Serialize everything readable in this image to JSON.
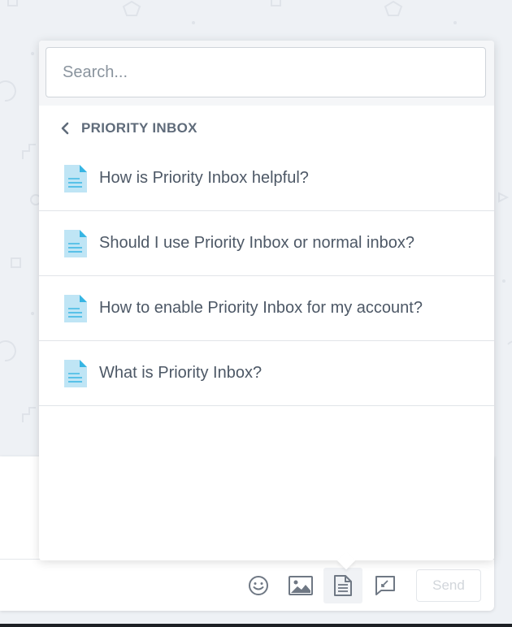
{
  "search": {
    "placeholder": "Search..."
  },
  "category": {
    "title": "PRIORITY INBOX"
  },
  "articles": [
    {
      "title": "How is Priority Inbox helpful?"
    },
    {
      "title": "Should I use Priority Inbox or normal inbox?"
    },
    {
      "title": "How to enable Priority Inbox for my account?"
    },
    {
      "title": "What is Priority Inbox?"
    }
  ],
  "toolbar": {
    "send_label": "Send",
    "icons": [
      "emoji-icon",
      "image-icon",
      "article-icon",
      "canned-response-icon"
    ]
  },
  "colors": {
    "background": "#eef1f5",
    "doc_icon": "#bfe5f5",
    "doc_icon_accent": "#36b5e3",
    "text": "#4d5866"
  }
}
